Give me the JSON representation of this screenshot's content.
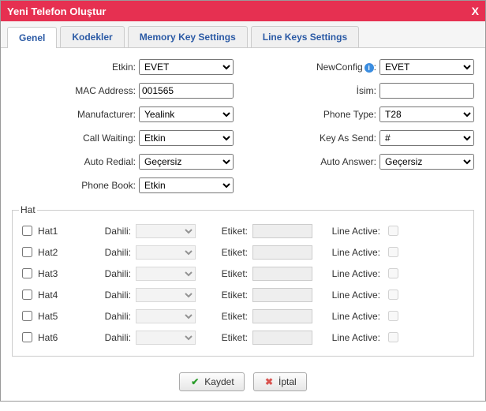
{
  "window": {
    "title": "Yeni Telefon Oluştur",
    "close": "X"
  },
  "tabs": {
    "general": "Genel",
    "codecs": "Kodekler",
    "memoryKeys": "Memory Key Settings",
    "lineKeys": "Line Keys Settings"
  },
  "fields": {
    "etkin": {
      "label": "Etkin:",
      "value": "EVET"
    },
    "newConfig": {
      "label": "NewConfig",
      "value": "EVET"
    },
    "mac": {
      "label": "MAC Address:",
      "value": "001565"
    },
    "isim": {
      "label": "İsim:",
      "value": ""
    },
    "manufacturer": {
      "label": "Manufacturer:",
      "value": "Yealink"
    },
    "phoneType": {
      "label": "Phone Type:",
      "value": "T28"
    },
    "callWaiting": {
      "label": "Call Waiting:",
      "value": "Etkin"
    },
    "keyAsSend": {
      "label": "Key As Send:",
      "value": "#"
    },
    "autoRedial": {
      "label": "Auto Redial:",
      "value": "Geçersiz"
    },
    "autoAnswer": {
      "label": "Auto Answer:",
      "value": "Geçersiz"
    },
    "phoneBook": {
      "label": "Phone Book:",
      "value": "Etkin"
    }
  },
  "hatSection": {
    "legend": "Hat",
    "dahiliLabel": "Dahili:",
    "etiketLabel": "Etiket:",
    "lineActiveLabel": "Line Active:",
    "rows": [
      {
        "name": "Hat1",
        "checked": false,
        "dahili": "",
        "etiket": "",
        "active": false
      },
      {
        "name": "Hat2",
        "checked": false,
        "dahili": "",
        "etiket": "",
        "active": false
      },
      {
        "name": "Hat3",
        "checked": false,
        "dahili": "",
        "etiket": "",
        "active": false
      },
      {
        "name": "Hat4",
        "checked": false,
        "dahili": "",
        "etiket": "",
        "active": false
      },
      {
        "name": "Hat5",
        "checked": false,
        "dahili": "",
        "etiket": "",
        "active": false
      },
      {
        "name": "Hat6",
        "checked": false,
        "dahili": "",
        "etiket": "",
        "active": false
      }
    ]
  },
  "buttons": {
    "save": "Kaydet",
    "cancel": "İptal"
  }
}
